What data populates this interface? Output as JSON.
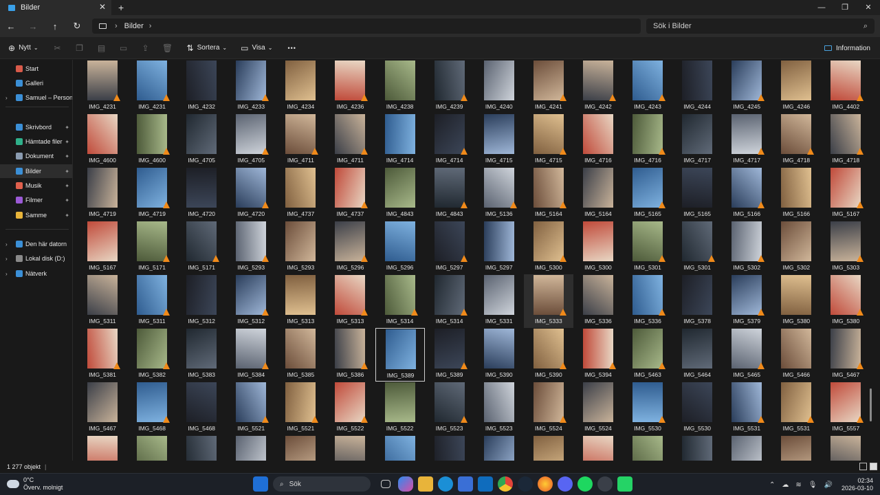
{
  "window": {
    "tab_title": "Bilder",
    "tab_close": "✕",
    "new_tab": "+",
    "minimize": "—",
    "maximize": "❐",
    "close": "✕"
  },
  "address": {
    "back": "←",
    "forward": "→",
    "up": "↑",
    "refresh": "↻",
    "breadcrumb": "Bilder",
    "chevron": "›",
    "search_placeholder": "Sök i Bilder",
    "search_icon": "⌕"
  },
  "commands": {
    "new_label": "Nytt",
    "sort_label": "Sortera",
    "view_label": "Visa",
    "more": "•••",
    "info_label": "Information"
  },
  "sidebar": {
    "items": [
      {
        "label": "Start",
        "icon": "home-icon",
        "color": "#d85a4a",
        "pinned": false
      },
      {
        "label": "Galleri",
        "icon": "gallery-icon",
        "color": "#3b8fd6",
        "pinned": false
      },
      {
        "label": "Samuel – Personlig",
        "icon": "onedrive-icon",
        "color": "#3b8fd6",
        "pinned": false
      },
      {
        "label": "Skrivbord",
        "icon": "desktop-icon",
        "color": "#3b8fd6",
        "pinned": true
      },
      {
        "label": "Hämtade filer",
        "icon": "downloads-icon",
        "color": "#2fb08a",
        "pinned": true
      },
      {
        "label": "Dokument",
        "icon": "documents-icon",
        "color": "#8a9bb0",
        "pinned": true
      },
      {
        "label": "Bilder",
        "icon": "pictures-icon",
        "color": "#3b8fd6",
        "pinned": true
      },
      {
        "label": "Musik",
        "icon": "music-icon",
        "color": "#e0604d",
        "pinned": true
      },
      {
        "label": "Filmer",
        "icon": "videos-icon",
        "color": "#9b5ad6",
        "pinned": true
      },
      {
        "label": "Samme",
        "icon": "folder-icon",
        "color": "#e8b43a",
        "pinned": true
      },
      {
        "label": "Den här datorn",
        "icon": "this-pc-icon",
        "color": "#3b8fd6",
        "pinned": false
      },
      {
        "label": "Lokal disk (D:)",
        "icon": "drive-icon",
        "color": "#8a8a8a",
        "pinned": false
      },
      {
        "label": "Nätverk",
        "icon": "network-icon",
        "color": "#3b8fd6",
        "pinned": false
      }
    ]
  },
  "files": [
    "IMG_4231",
    "IMG_4231",
    "IMG_4232",
    "IMG_4233",
    "IMG_4234",
    "IMG_4236",
    "IMG_4238",
    "IMG_4239",
    "IMG_4240",
    "IMG_4241",
    "IMG_4242",
    "IMG_4243",
    "IMG_4244",
    "IMG_4245",
    "IMG_4246",
    "IMG_4402",
    "IMG_4600",
    "IMG_4600",
    "IMG_4705",
    "IMG_4705",
    "IMG_4711",
    "IMG_4711",
    "IMG_4714",
    "IMG_4714",
    "IMG_4715",
    "IMG_4715",
    "IMG_4716",
    "IMG_4716",
    "IMG_4717",
    "IMG_4717",
    "IMG_4718",
    "IMG_4718",
    "IMG_4719",
    "IMG_4719",
    "IMG_4720",
    "IMG_4720",
    "IMG_4737",
    "IMG_4737",
    "IMG_4843",
    "IMG_4843",
    "IMG_5136",
    "IMG_5164",
    "IMG_5164",
    "IMG_5165",
    "IMG_5165",
    "IMG_5166",
    "IMG_5166",
    "IMG_5167",
    "IMG_5167",
    "IMG_5171",
    "IMG_5171",
    "IMG_5293",
    "IMG_5293",
    "IMG_5296",
    "IMG_5296",
    "IMG_5297",
    "IMG_5297",
    "IMG_5300",
    "IMG_5300",
    "IMG_5301",
    "IMG_5301",
    "IMG_5302",
    "IMG_5302",
    "IMG_5303",
    "IMG_5311",
    "IMG_5311",
    "IMG_5312",
    "IMG_5312",
    "IMG_5313",
    "IMG_5313",
    "IMG_5314",
    "IMG_5314",
    "IMG_5331",
    "IMG_5333",
    "IMG_5336",
    "IMG_5336",
    "IMG_5378",
    "IMG_5379",
    "IMG_5380",
    "IMG_5380",
    "IMG_5381",
    "IMG_5382",
    "IMG_5383",
    "IMG_5384",
    "IMG_5385",
    "IMG_5386",
    "IMG_5389",
    "IMG_5389",
    "IMG_5390",
    "IMG_5390",
    "IMG_5394",
    "IMG_5463",
    "IMG_5464",
    "IMG_5465",
    "IMG_5466",
    "IMG_5467",
    "IMG_5467",
    "IMG_5468",
    "IMG_5468",
    "IMG_5521",
    "IMG_5521",
    "IMG_5522",
    "IMG_5522",
    "IMG_5523",
    "IMG_5523",
    "IMG_5524",
    "IMG_5524",
    "IMG_5530",
    "IMG_5530",
    "IMG_5531",
    "IMG_5531",
    "IMG_5557",
    "",
    "",
    "",
    "",
    "",
    "",
    "",
    "",
    "",
    "",
    "",
    "",
    "",
    "",
    "",
    ""
  ],
  "selected_file_index": 86,
  "hovered_file_index": 73,
  "status": {
    "item_count": "1 277 objekt"
  },
  "taskbar": {
    "temperature": "0°C",
    "weather_desc": "Överv. molnigt",
    "search_label": "Sök",
    "time": "02:34",
    "date": "2026-03-10"
  }
}
